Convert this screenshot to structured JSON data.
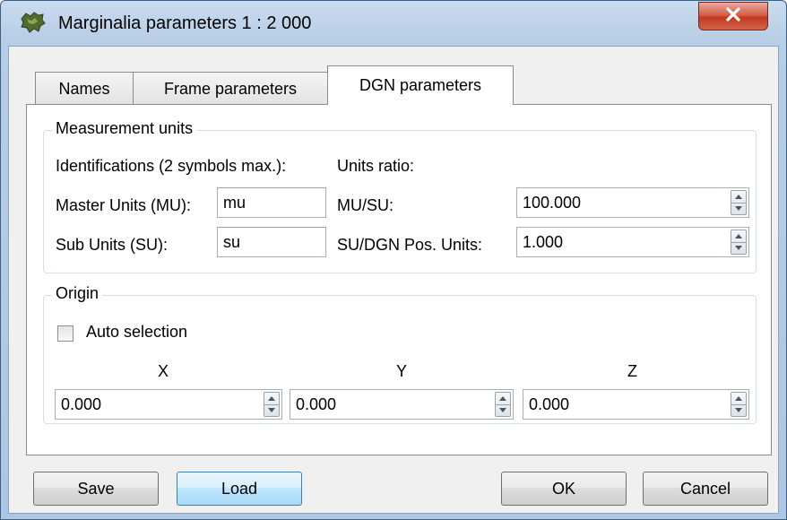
{
  "window": {
    "title": "Marginalia parameters 1 : 2 000"
  },
  "tabs": [
    {
      "label": "Names"
    },
    {
      "label": "Frame parameters"
    },
    {
      "label": "DGN parameters"
    }
  ],
  "measurement": {
    "group_title": "Measurement units",
    "identifications_label": "Identifications (2 symbols max.):",
    "units_ratio_label": "Units ratio:",
    "master_units_label": "Master Units (MU):",
    "master_units_value": "mu",
    "sub_units_label": "Sub Units (SU):",
    "sub_units_value": "su",
    "mu_su_label": "MU/SU:",
    "mu_su_value": "100.000",
    "su_dgn_label": "SU/DGN Pos. Units:",
    "su_dgn_value": "1.000"
  },
  "origin": {
    "group_title": "Origin",
    "auto_selection_label": "Auto selection",
    "auto_selection_checked": false,
    "x_label": "X",
    "y_label": "Y",
    "z_label": "Z",
    "x_value": "0.000",
    "y_value": "0.000",
    "z_value": "0.000"
  },
  "buttons": {
    "save": "Save",
    "load": "Load",
    "ok": "OK",
    "cancel": "Cancel"
  },
  "icons": {
    "app": "map-icon",
    "close": "close-icon"
  },
  "colors": {
    "titlebar": "#b7cde6",
    "close_button": "#c1391f",
    "focus_border": "#3c7fb1"
  }
}
